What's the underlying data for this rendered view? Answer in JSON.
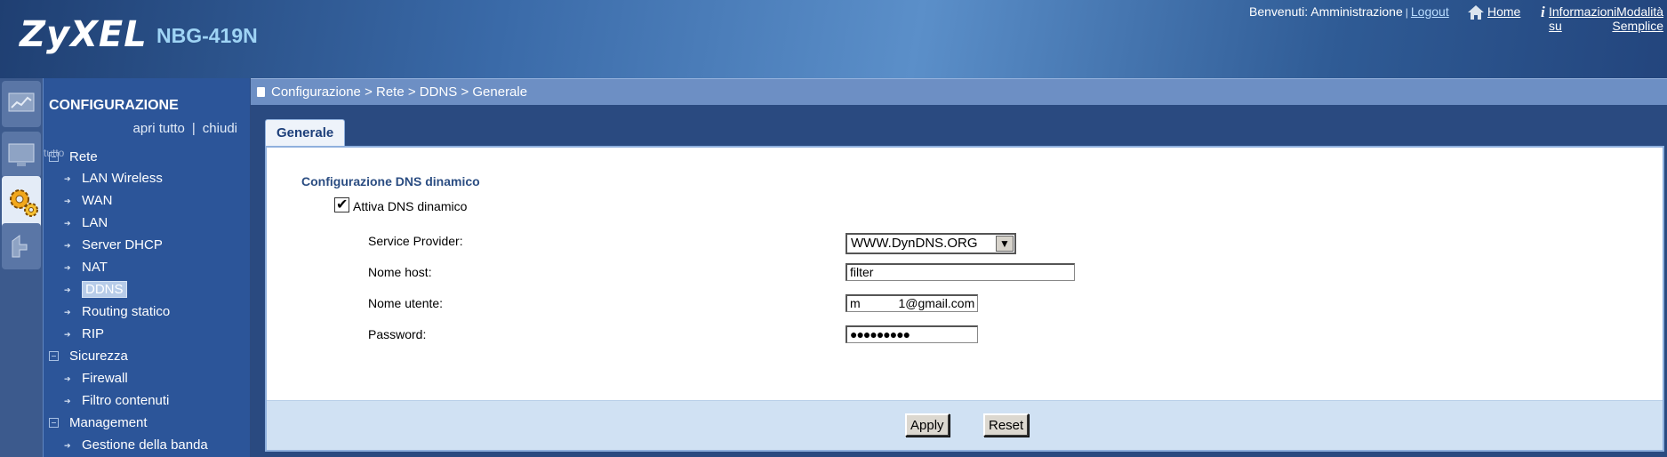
{
  "header": {
    "brand": "ZyXEL",
    "model": "NBG-419N",
    "welcome": "Benvenuti: Amministrazione",
    "logout": "Logout",
    "home": "Home",
    "info": "Informazioni su",
    "mode": "Modalità Semplice"
  },
  "sidebar": {
    "title": "CONFIGURAZIONE",
    "expand_all": "apri tutto",
    "collapse_all": "chiudi",
    "overlap_text": "tutto",
    "groups": [
      {
        "label": "Rete",
        "items": [
          "LAN Wireless",
          "WAN",
          "LAN",
          "Server DHCP",
          "NAT",
          "DDNS",
          "Routing statico",
          "RIP"
        ]
      },
      {
        "label": "Sicurezza",
        "items": [
          "Firewall",
          "Filtro contenuti"
        ]
      },
      {
        "label": "Management",
        "items": [
          "Gestione della banda"
        ]
      }
    ],
    "active_item": "DDNS"
  },
  "breadcrumb": "Configurazione > Rete > DDNS > Generale",
  "tab": "Generale",
  "form": {
    "section_title": "Configurazione DNS dinamico",
    "enable_label": "Attiva DNS dinamico",
    "enable_checked": true,
    "provider_label": "Service Provider:",
    "provider_value": "WWW.DynDNS.ORG",
    "host_label": "Nome host:",
    "host_value": "filter",
    "user_label": "Nome utente:",
    "user_value": "m           1@gmail.com",
    "password_label": "Password:",
    "password_value": "●●●●●●●●●"
  },
  "buttons": {
    "apply": "Apply",
    "reset": "Reset"
  },
  "colors": {
    "sidebar_bg": "#2c5599",
    "breadcrumb_bg": "#6d8fc4",
    "button_bar_bg": "#d0e1f3",
    "title_text": "#2b4d82"
  }
}
